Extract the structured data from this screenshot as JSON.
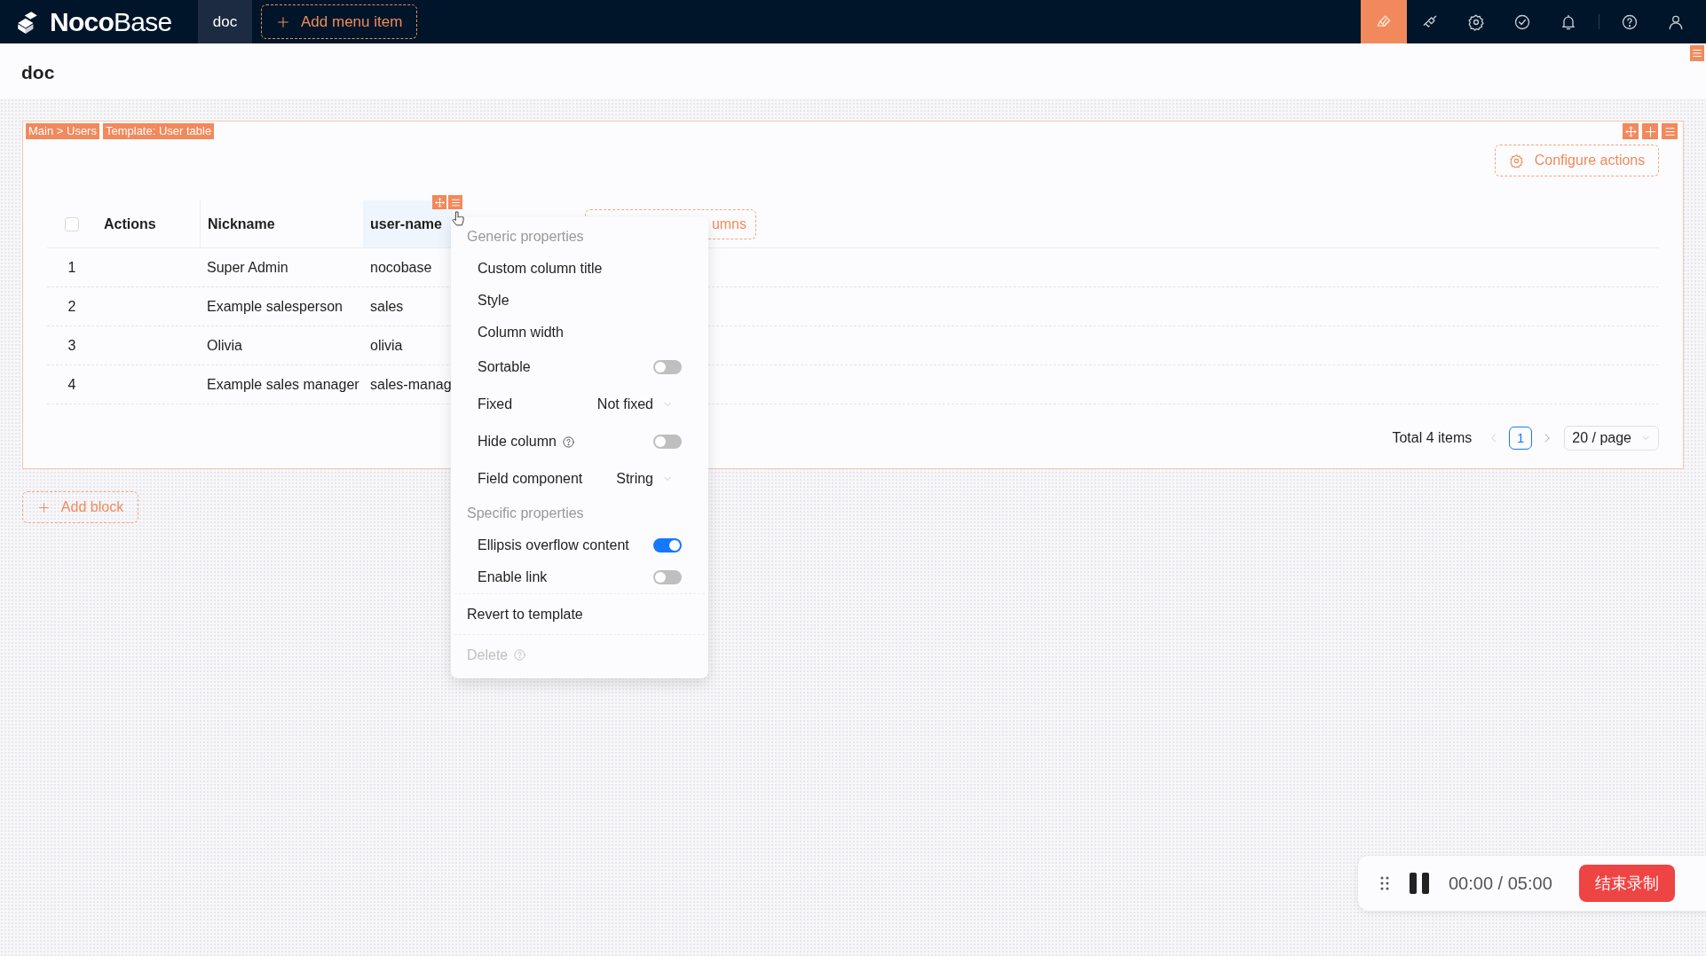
{
  "topbar": {
    "logo": "**Noco**Base",
    "menu": [
      {
        "label": "doc",
        "selected": true
      }
    ],
    "add_menu_item": "Add menu item"
  },
  "page": {
    "title": "doc"
  },
  "block": {
    "tags": [
      "Main > Users",
      "Template: User table"
    ],
    "configure_actions": "Configure actions",
    "table": {
      "select_all": {
        "checked": false
      },
      "columns": [
        {
          "label": "Actions",
          "highlighted": false
        },
        {
          "label": "Nickname",
          "highlighted": false
        },
        {
          "label": "user-name",
          "highlighted": true
        }
      ],
      "configure_columns": "umns",
      "rows": [
        {
          "index": "1",
          "nickname": "Super Admin",
          "username": "nocobase"
        },
        {
          "index": "2",
          "nickname": "Example salesperson",
          "username": "sales"
        },
        {
          "index": "3",
          "nickname": "Olivia",
          "username": "olivia"
        },
        {
          "index": "4",
          "nickname": "Example sales manager",
          "username": "sales-manag"
        }
      ]
    },
    "pagination": {
      "total": "Total 4 items",
      "pages": [
        {
          "label": "1",
          "selected": true
        }
      ],
      "page_size": "20 / page"
    }
  },
  "add_block": "Add block",
  "context_menu": [
    {
      "kind": "header",
      "label": "Generic properties"
    },
    {
      "kind": "item",
      "label": "Custom column title"
    },
    {
      "kind": "item",
      "label": "Style"
    },
    {
      "kind": "item",
      "label": "Column width"
    },
    {
      "kind": "toggle",
      "label": "Sortable",
      "on": false
    },
    {
      "kind": "select",
      "label": "Fixed",
      "value": "Not fixed"
    },
    {
      "kind": "toggle",
      "label": "Hide column",
      "on": false,
      "help": true
    },
    {
      "kind": "select",
      "label": "Field component",
      "value": "String"
    },
    {
      "kind": "header",
      "label": "Specific properties"
    },
    {
      "kind": "toggle",
      "label": "Ellipsis overflow content",
      "on": true
    },
    {
      "kind": "toggle",
      "label": "Enable link",
      "on": false
    },
    {
      "kind": "action",
      "label": "Revert to template",
      "disabled": false
    },
    {
      "kind": "action",
      "label": "Delete",
      "disabled": true,
      "help": true
    }
  ],
  "recorder": {
    "time": "00:00 / 05:00",
    "stop": "结束录制"
  }
}
